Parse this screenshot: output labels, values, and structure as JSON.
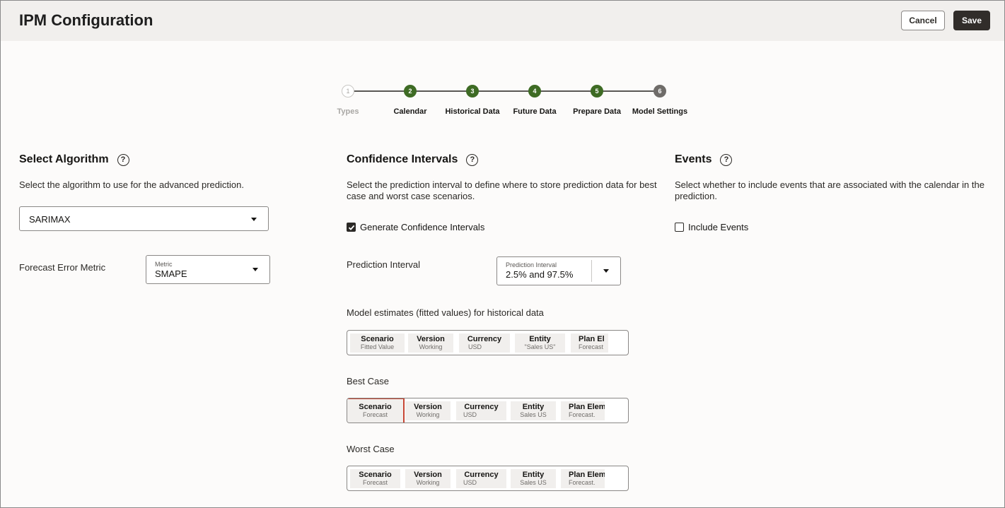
{
  "header": {
    "title": "IPM Configuration",
    "cancel_label": "Cancel",
    "save_label": "Save"
  },
  "stepper": {
    "steps": [
      {
        "num": "1",
        "label": "Types",
        "state": "todo"
      },
      {
        "num": "2",
        "label": "Calendar",
        "state": "done"
      },
      {
        "num": "3",
        "label": "Historical Data",
        "state": "done"
      },
      {
        "num": "4",
        "label": "Future Data",
        "state": "done"
      },
      {
        "num": "5",
        "label": "Prepare Data",
        "state": "done"
      },
      {
        "num": "6",
        "label": "Model Settings",
        "state": "current"
      }
    ]
  },
  "algorithm": {
    "title": "Select Algorithm",
    "help_icon": "?",
    "description": "Select the algorithm to use for the advanced prediction.",
    "selected": "SARIMAX",
    "error_metric_label": "Forecast Error Metric",
    "metric_field_label": "Metric",
    "metric_value": "SMAPE"
  },
  "confidence": {
    "title": "Confidence Intervals",
    "help_icon": "?",
    "description": "Select the prediction interval to define where to store prediction data for best case and worst case scenarios.",
    "generate_label": "Generate Confidence Intervals",
    "generate_checked": true,
    "prediction_interval_label": "Prediction Interval",
    "prediction_field_label": "Prediction Interval",
    "prediction_value": "2.5% and 97.5%",
    "fitted_label": "Model estimates (fitted values) for historical data",
    "fitted_pov": [
      {
        "dim": "Scenario",
        "mem": "Fitted Value"
      },
      {
        "dim": "Version",
        "mem": "Working"
      },
      {
        "dim": "Currency",
        "mem": "USD"
      },
      {
        "dim": "Entity",
        "mem": "\"Sales US\""
      },
      {
        "dim": "Plan El",
        "mem": "Forecast"
      }
    ],
    "best_case_label": "Best Case",
    "best_pov": [
      {
        "dim": "Scenario",
        "mem": "Forecast"
      },
      {
        "dim": "Version",
        "mem": "Working"
      },
      {
        "dim": "Currency",
        "mem": "USD"
      },
      {
        "dim": "Entity",
        "mem": "Sales US"
      },
      {
        "dim": "Plan Elem",
        "mem": "Forecast."
      }
    ],
    "worst_case_label": "Worst Case",
    "worst_pov": [
      {
        "dim": "Scenario",
        "mem": "Forecast"
      },
      {
        "dim": "Version",
        "mem": "Working"
      },
      {
        "dim": "Currency",
        "mem": "USD"
      },
      {
        "dim": "Entity",
        "mem": "Sales US"
      },
      {
        "dim": "Plan Elem",
        "mem": "Forecast."
      }
    ]
  },
  "events": {
    "title": "Events",
    "help_icon": "?",
    "description": "Select whether to include events that are associated with the calendar in the prediction.",
    "include_label": "Include Events",
    "include_checked": false
  },
  "colors": {
    "step_done": "#3e6b24",
    "selected_outline": "#c74634",
    "save_button": "#312d2a"
  }
}
